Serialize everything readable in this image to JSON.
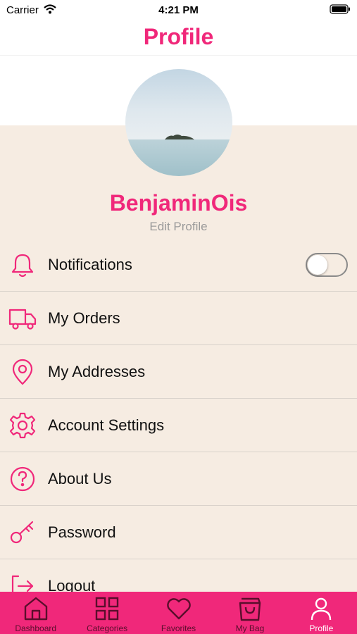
{
  "status_bar": {
    "carrier": "Carrier",
    "time": "4:21 PM"
  },
  "header": {
    "title": "Profile"
  },
  "profile": {
    "username": "BenjaminOis",
    "edit_label": "Edit Profile"
  },
  "menu": [
    {
      "label": "Notifications",
      "icon": "bell-icon",
      "toggle": false
    },
    {
      "label": "My Orders",
      "icon": "truck-icon"
    },
    {
      "label": "My Addresses",
      "icon": "location-pin-icon"
    },
    {
      "label": "Account Settings",
      "icon": "gear-icon"
    },
    {
      "label": "About Us",
      "icon": "question-circle-icon"
    },
    {
      "label": "Password",
      "icon": "key-icon"
    },
    {
      "label": "Logout",
      "icon": "logout-icon"
    }
  ],
  "tabs": [
    {
      "label": "Dashboard",
      "icon": "home-icon"
    },
    {
      "label": "Categories",
      "icon": "grid-icon"
    },
    {
      "label": "Favorites",
      "icon": "heart-icon"
    },
    {
      "label": "My Bag",
      "icon": "shopping-bag-icon"
    },
    {
      "label": "Profile",
      "icon": "user-icon",
      "active": true
    }
  ],
  "colors": {
    "accent": "#f0287a",
    "background": "#f6ece2",
    "divider": "#d9d2cb"
  }
}
